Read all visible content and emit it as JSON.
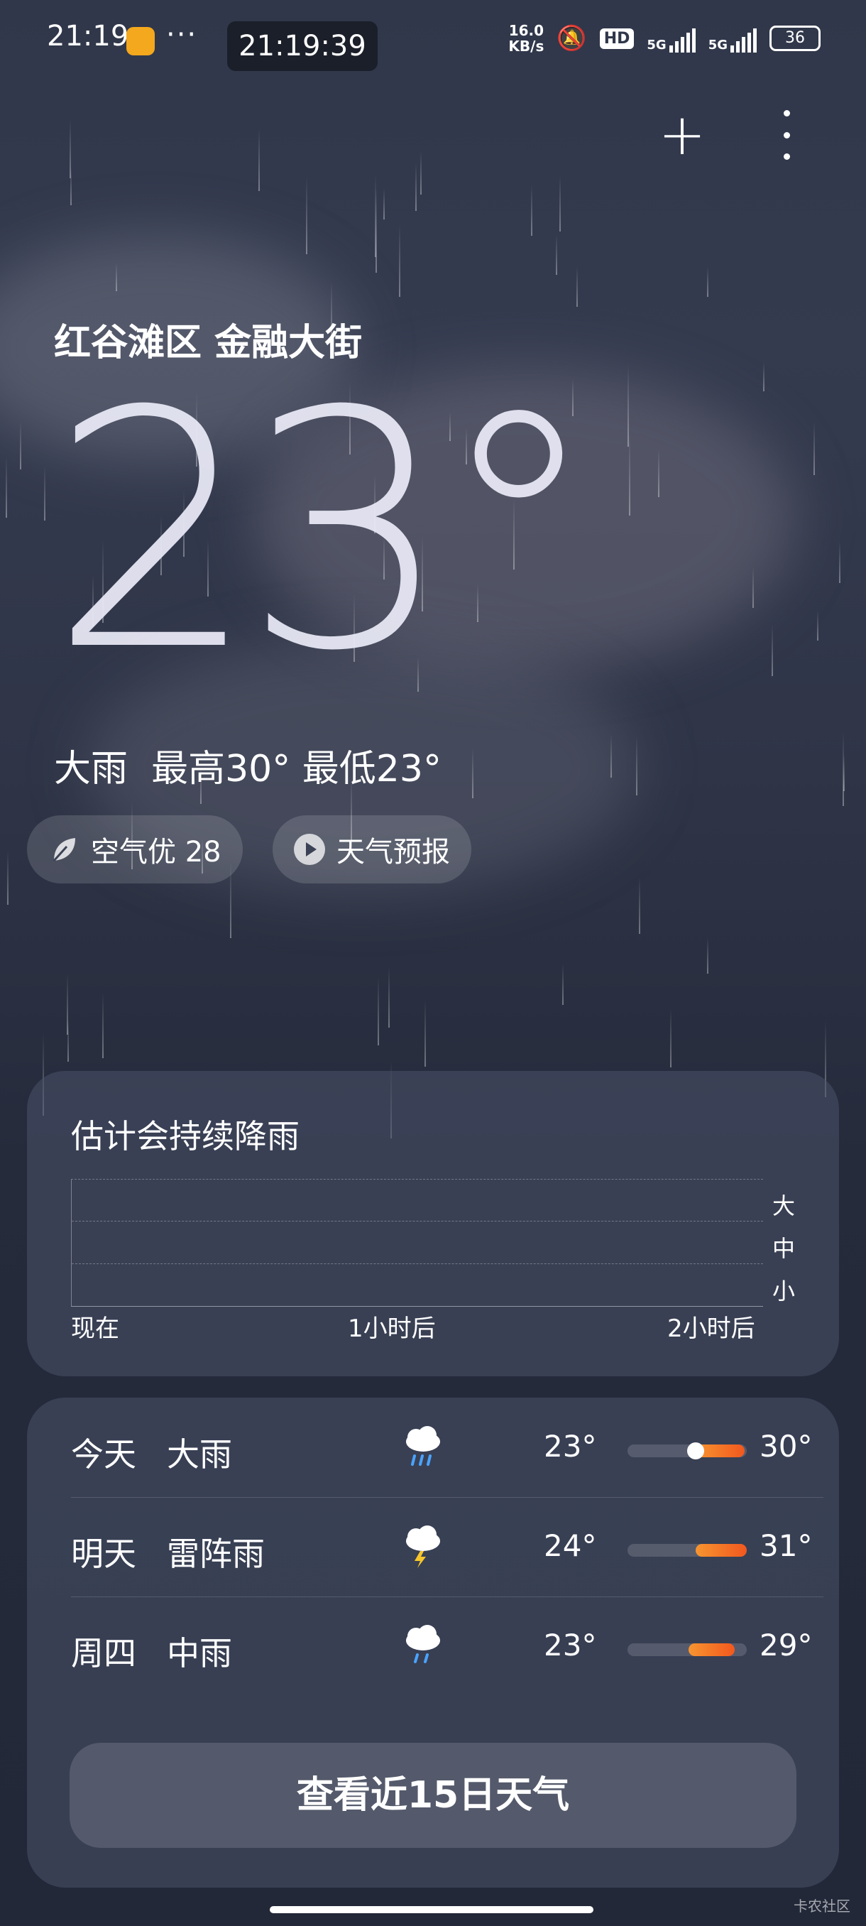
{
  "status_bar": {
    "time": "21:19",
    "more": "···",
    "clock": "21:19:39",
    "net_speed": "16.0\nKB/s",
    "hd": "HD",
    "sim1": "5G",
    "sim2": "5G",
    "battery": "36",
    "app_icon_color": "#f4a81d"
  },
  "header": {
    "add_icon": "plus-icon",
    "menu_icon": "more-vertical-icon"
  },
  "location": "红谷滩区 金融大街",
  "current": {
    "temperature": "23°",
    "condition": "大雨",
    "high": "最高30°",
    "low": "最低23°"
  },
  "chips": {
    "air_quality": "空气优 28",
    "forecast_video": "天气预报"
  },
  "rain_card": {
    "title": "估计会持续降雨",
    "levels": [
      "大",
      "中",
      "小"
    ],
    "time_labels": [
      "现在",
      "1小时后",
      "2小时后"
    ]
  },
  "forecast": {
    "rows": [
      {
        "day": "今天",
        "desc": "大雨",
        "icon": "heavy-rain-icon",
        "low": "23°",
        "high": "30°",
        "range_start": 0.57,
        "range_end": 0.98,
        "current": 0.57
      },
      {
        "day": "明天",
        "desc": "雷阵雨",
        "icon": "thunderstorm-icon",
        "low": "24°",
        "high": "31°",
        "range_start": 0.57,
        "range_end": 1.0,
        "current": null
      },
      {
        "day": "周四",
        "desc": "中雨",
        "icon": "moderate-rain-icon",
        "low": "23°",
        "high": "29°",
        "range_start": 0.51,
        "range_end": 0.9,
        "current": null
      }
    ],
    "more_button": "查看近15日天气"
  },
  "watermark": "卡农社区",
  "colors": {
    "accent_orange": "#f2581e",
    "bar_start": "#f79530"
  }
}
